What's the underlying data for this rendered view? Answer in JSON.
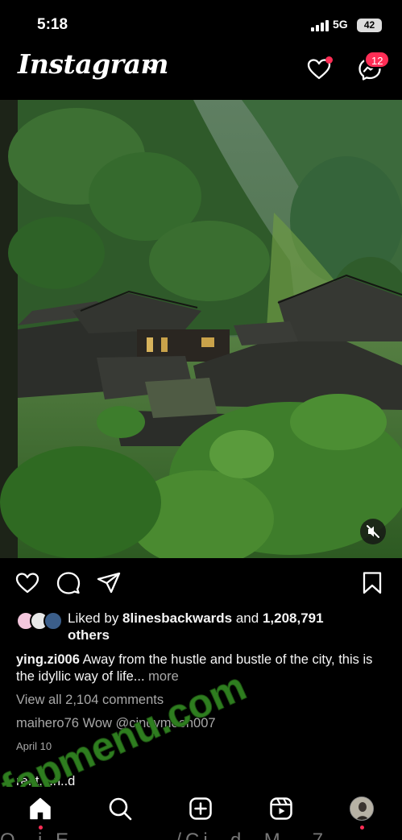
{
  "status_bar": {
    "time": "5:18",
    "network": "5G",
    "battery": "42"
  },
  "header": {
    "logo": "Instagram",
    "messages_badge": "12",
    "icons": [
      "chevron-down-icon",
      "heart-icon",
      "messenger-icon"
    ]
  },
  "post": {
    "likes": {
      "prefix": "Liked by ",
      "liker": "8linesbackwards",
      "connector": " and ",
      "count": "1,208,791",
      "suffix": "others"
    },
    "caption": {
      "username": "ying.zi006",
      "text": "Away from the hustle and bustle of the city, this is the idyllic way of life...",
      "more": "more"
    },
    "view_comments": "View all 2,104 comments",
    "top_comment": {
      "username": "maihero76",
      "text": "Wow @cindymoon007"
    },
    "date": "April 10",
    "partial_text": "re..t.i..n..d",
    "watermark": "fapmenu.com"
  },
  "nav": {
    "items": [
      "home-icon",
      "search-icon",
      "create-icon",
      "reels-icon",
      "profile-avatar"
    ]
  },
  "bottom_fragment": "Q. i  E.........../Ci..d..M...7",
  "colors": {
    "accent_red": "#ff2d55",
    "watermark_green": "#2e7d1f",
    "muted_text": "#a8a8a8"
  }
}
